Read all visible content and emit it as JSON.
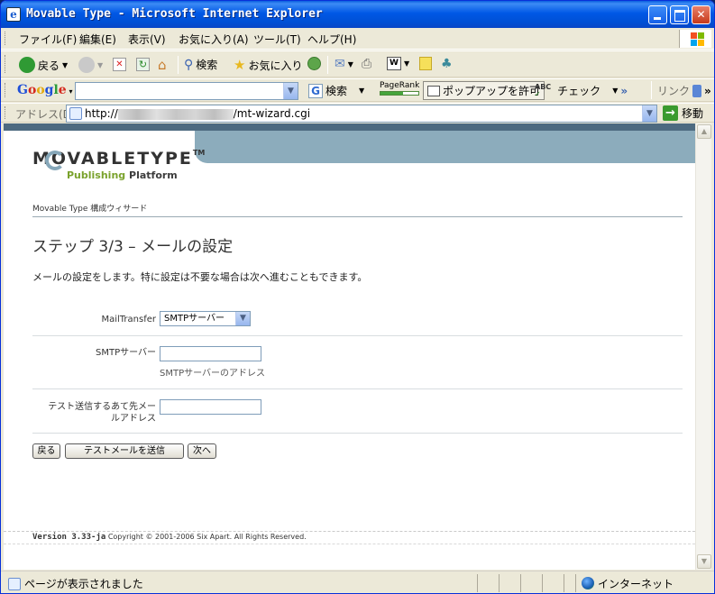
{
  "window": {
    "title": "Movable Type - Microsoft Internet Explorer",
    "app_icon": "e"
  },
  "menu": {
    "items": [
      "ファイル(F)",
      "編集(E)",
      "表示(V)",
      "お気に入り(A)",
      "ツール(T)",
      "ヘルプ(H)"
    ]
  },
  "toolbar": {
    "back_label": "戻る",
    "search_label": "検索",
    "favorites_label": "お気に入り"
  },
  "google_bar": {
    "logo": "Google",
    "search_button": "検索",
    "pagerank_label": "PageRank",
    "popup_button": "ポップアップを許可",
    "check_button": "チェック",
    "links_label": "リンク"
  },
  "address_bar": {
    "label": "アドレス(D)",
    "url_prefix": "http://",
    "url_suffix": "/mt-wizard.cgi",
    "go_label": "移動"
  },
  "page": {
    "logo_wordmark": "MOVABLETYPE",
    "logo_tm": "TM",
    "logo_tagline_1": "Publishing",
    "logo_tagline_2": "Platform",
    "breadcrumb": "Movable Type 構成ウィサード",
    "title": "ステップ 3/3 – メールの設定",
    "intro": "メールの設定をします。特に設定は不要な場合は次へ進むこともできます。",
    "fields": {
      "mail_transfer": {
        "label": "MailTransfer",
        "value": "SMTPサーバー"
      },
      "smtp_server": {
        "label": "SMTPサーバー",
        "value": "",
        "hint": "SMTPサーバーのアドレス"
      },
      "test_address": {
        "label_line1": "テスト送信するあて先メー",
        "label_line2": "ルアドレス",
        "value": ""
      }
    },
    "buttons": {
      "back": "戻る",
      "send_test": "テストメールを送信",
      "next": "次へ"
    },
    "footer": {
      "version": "Version 3.33-ja",
      "copyright": "Copyright © 2001-2006 Six Apart. All Rights Reserved."
    }
  },
  "status_bar": {
    "message": "ページが表示されました",
    "zone": "インターネット"
  },
  "colors": {
    "titlebar": "#0058e6",
    "header_band": "#4d6a80",
    "header_bar": "#8cacbc",
    "logo_accent": "#7aa22c"
  }
}
